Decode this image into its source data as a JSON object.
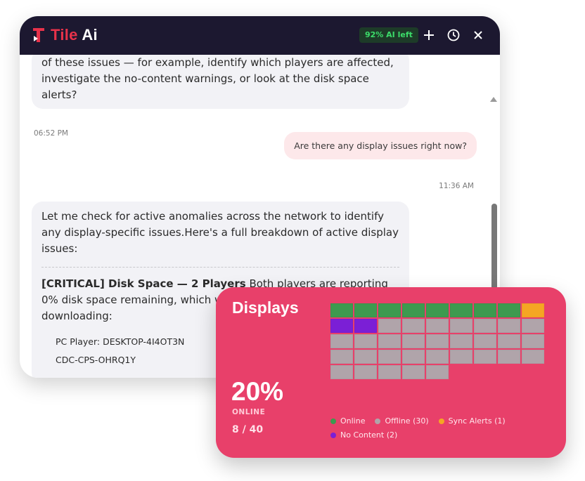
{
  "app": {
    "name_part1": "Tile",
    "name_part2": "Ai",
    "credits_badge": "92% AI left"
  },
  "messages": {
    "ai_1_text": "of these issues — for example, identify which players are affected, investigate the no-content warnings, or look at the disk space alerts?",
    "ai_1_time": "06:52 PM",
    "user_1_text": "Are there any display issues right now?",
    "user_1_time": "11:36 AM",
    "ai_2_intro": "Let me check for active anomalies across the network to identify any display-specific issues.Here's a full breakdown of active display issues:",
    "ai_2_issue_title": "[CRITICAL] Disk Space — 2 Players",
    "ai_2_issue_body": " Both players are reporting 0% disk space remaining, which will prevent new content from downloading:",
    "ai_2_player_1": "PC Player: DESKTOP-4I4OT3N",
    "ai_2_player_2": "CDC-CPS-OHRQ1Y"
  },
  "displays": {
    "title": "Displays",
    "percent": "20%",
    "percent_label": "ONLINE",
    "count": "8 / 40",
    "colors": {
      "online": "#3d9a4f",
      "offline": "#b0a4aa",
      "sync": "#f5a623",
      "nocontent": "#7b1fd6"
    },
    "tiles": [
      "online",
      "online",
      "online",
      "online",
      "online",
      "online",
      "online",
      "online",
      "sync",
      "nocontent",
      "nocontent",
      "offline",
      "offline",
      "offline",
      "offline",
      "offline",
      "offline",
      "offline",
      "offline",
      "offline",
      "offline",
      "offline",
      "offline",
      "offline",
      "offline",
      "offline",
      "offline",
      "offline",
      "offline",
      "offline",
      "offline",
      "offline",
      "offline",
      "offline",
      "offline",
      "offline",
      "offline",
      "offline",
      "offline",
      "offline",
      "offline"
    ],
    "legend": {
      "online": "Online",
      "offline": "Offline (30)",
      "sync": "Sync Alerts (1)",
      "nocontent": "No Content (2)"
    }
  }
}
